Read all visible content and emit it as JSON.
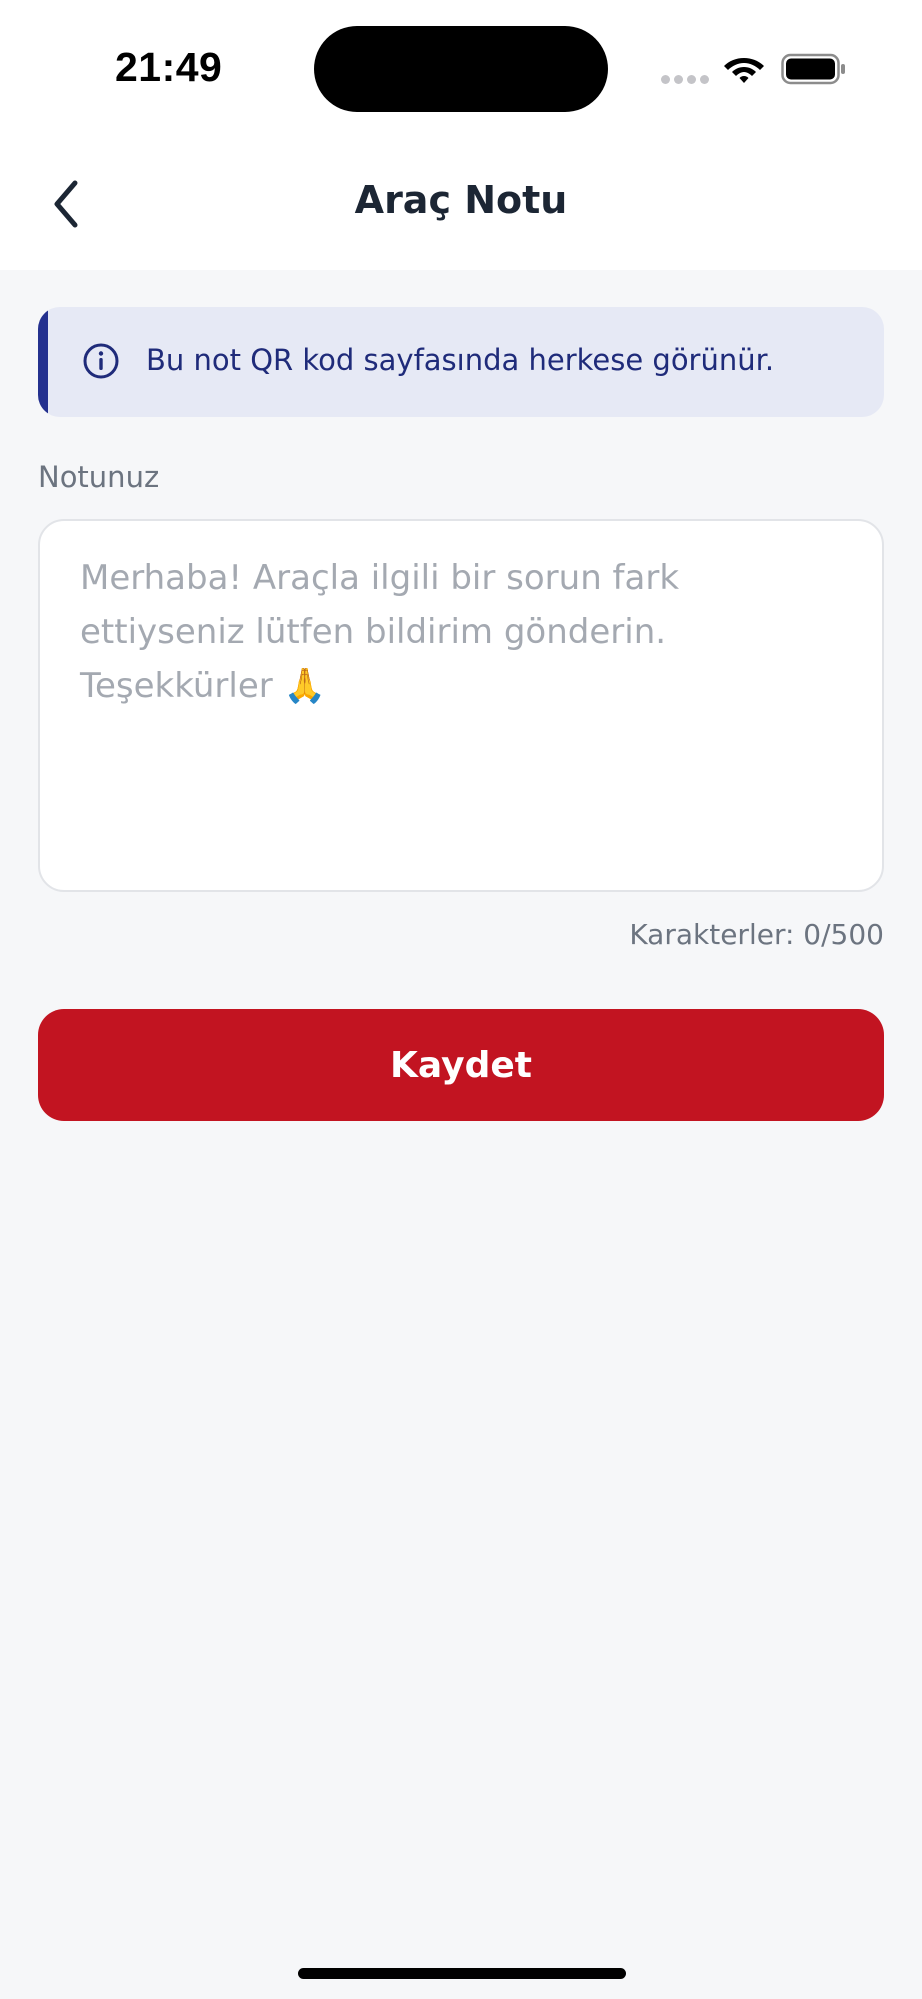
{
  "status_bar": {
    "time": "21:49"
  },
  "nav": {
    "title": "Araç Notu",
    "back_icon": "chevron-left-icon"
  },
  "info_banner": {
    "icon": "info-circle-icon",
    "text": "Bu not QR kod sayfasında herkese görünür.",
    "accent_color": "#24318f",
    "background_color": "#e6e9f5"
  },
  "note_field": {
    "label": "Notunuz",
    "value": "",
    "placeholder": "Merhaba! Araçla ilgili bir sorun fark ettiyseniz lütfen bildirim gönderin. Teşekkürler 🙏",
    "counter": "Karakterler: 0/500"
  },
  "save_button": {
    "label": "Kaydet",
    "color": "#c21421"
  }
}
